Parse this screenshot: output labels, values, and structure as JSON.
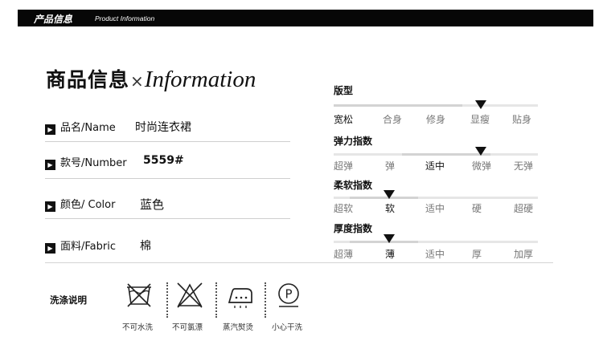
{
  "header": {
    "title_cn": "产品信息",
    "title_en": "Product Information"
  },
  "heading": {
    "cn": "商品信息",
    "sep": "×",
    "en": "Information"
  },
  "info": [
    {
      "label": "品名/Name",
      "value": "时尚连衣裙"
    },
    {
      "label": "款号/Number",
      "value": "5559#"
    },
    {
      "label": "颜色/ Color",
      "value": "蓝色"
    },
    {
      "label": "面料/Fabric",
      "value": "棉"
    }
  ],
  "fit": [
    {
      "title": "版型",
      "options": [
        "宽松",
        "合身",
        "修身",
        "显瘦",
        "贴身"
      ],
      "selected": "宽松",
      "marker_at": "显瘦"
    },
    {
      "title": "弹力指数",
      "options": [
        "超弹",
        "弹",
        "适中",
        "微弹",
        "无弹"
      ],
      "selected": "适中",
      "marker_at": "微弹"
    },
    {
      "title": "柔软指数",
      "options": [
        "超软",
        "软",
        "适中",
        "硬",
        "超硬"
      ],
      "selected": "软",
      "marker_at": "软"
    },
    {
      "title": "厚度指数",
      "options": [
        "超薄",
        "薄",
        "适中",
        "厚",
        "加厚"
      ],
      "selected": "薄",
      "marker_at": "薄"
    }
  ],
  "care": {
    "title": "洗涤说明",
    "icons": [
      {
        "icon": "no-wash-icon",
        "label": "不可水洗"
      },
      {
        "icon": "no-bleach-icon",
        "label": "不可氯漂"
      },
      {
        "icon": "steam-iron-icon",
        "label": "蒸汽熨烫"
      },
      {
        "icon": "dry-clean-icon",
        "label": "小心干洗"
      }
    ]
  }
}
